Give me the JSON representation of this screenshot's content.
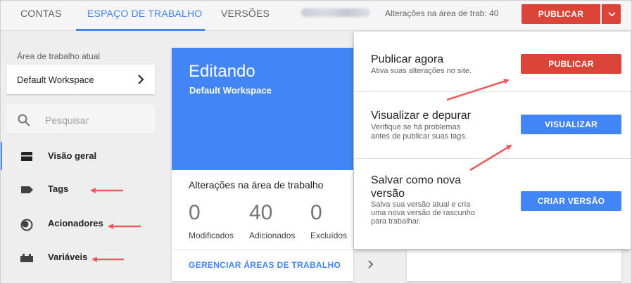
{
  "nav": {
    "tabs": [
      "CONTAS",
      "ESPAÇO DE TRABALHO",
      "VERSÕES"
    ],
    "active_tab": "ESPAÇO DE TRABALHO",
    "changes_text": "Alterações na área de trab: 40",
    "publish_label": "PUBLICAR"
  },
  "sidebar": {
    "workspace_label": "Área de trabalho atual",
    "workspace_name": "Default Workspace",
    "search_placeholder": "Pesquisar",
    "items": [
      {
        "label": "Visão geral",
        "icon": "overview-icon"
      },
      {
        "label": "Tags",
        "icon": "tag-icon"
      },
      {
        "label": "Acionadores",
        "icon": "trigger-icon"
      },
      {
        "label": "Variáveis",
        "icon": "variable-icon"
      }
    ]
  },
  "main": {
    "title": "Editando",
    "subtitle": "Default Workspace",
    "changes_title": "Alterações na área de trabalho",
    "stats": [
      {
        "value": "0",
        "label": "Modificados"
      },
      {
        "value": "40",
        "label": "Adicionados"
      },
      {
        "value": "0",
        "label": "Excluídos"
      }
    ],
    "manage_link": "GERENCIAR ÁREAS DE TRABALHO"
  },
  "publish_menu": {
    "options": [
      {
        "title": "Publicar agora",
        "description": [
          "Ativa suas alterações no site."
        ],
        "button": "PUBLICAR"
      },
      {
        "title": "Visualizar e depurar",
        "description": [
          "Verifique se há problemas",
          "antes de publicar suas tags."
        ],
        "button": "VISUALIZAR"
      },
      {
        "title_lines": [
          "Salvar como nova",
          "versão"
        ],
        "description": [
          "Salva sua versão atual e cria",
          "uma nova versão de rascunho",
          "para trabalhar."
        ],
        "button": "CRIAR VERSÃO"
      }
    ]
  },
  "colors": {
    "accent_blue": "#4285f4",
    "publish_red": "#db4437",
    "annotation_arrow": "#f05a5e"
  }
}
